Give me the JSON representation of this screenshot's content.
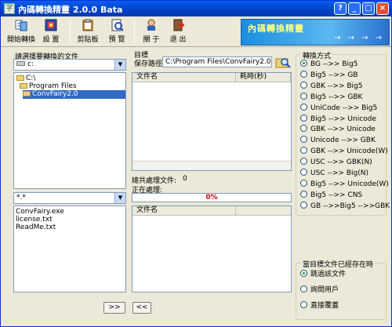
{
  "window": {
    "title": "內碼轉換精靈  2.0.0 Bata",
    "title_icon": "app-icon",
    "buttons": [
      "?",
      "_",
      "□",
      "×"
    ]
  },
  "toolbar": {
    "items": [
      {
        "label": "開始轉換",
        "icon": "convert-icon"
      },
      {
        "label": "設  置",
        "icon": "settings-icon"
      },
      {
        "label": "剪貼板",
        "icon": "clipboard-icon"
      },
      {
        "label": "預  覽",
        "icon": "preview-icon"
      },
      {
        "label": "關  于",
        "icon": "about-icon"
      },
      {
        "label": "退  出",
        "icon": "exit-icon"
      }
    ],
    "banner_text": "內碼轉換精靈",
    "banner_arrows": "→ → → →"
  },
  "left": {
    "heading": "請選擇要轉換的文件",
    "drive": "c:",
    "tree": [
      "C:\\",
      "Program Files",
      "ConvFairy2.0"
    ],
    "filter": "*.*",
    "files": [
      "ConvFairy.exe",
      "license.txt",
      "ReadMe.txt"
    ],
    "add_button": ">>"
  },
  "middle": {
    "heading": "目標",
    "save_path_label": "保存路徑",
    "save_path_value": "C:\\Program Files\\ConvFairy2.0",
    "columns": [
      "文件名",
      "耗時(秒)"
    ],
    "total_label": "總共處理文件:",
    "total_value": "0",
    "processing_label": "正在處理:",
    "progress_percent": 0,
    "progress_text": "0%",
    "queue_columns": [
      "文件名"
    ],
    "remove_button": "<<"
  },
  "right": {
    "heading": "轉換方式",
    "selected_index": 0,
    "options": [
      "BG -->> Big5",
      "Big5 -->> GB",
      "GBK -->> Big5",
      "Big5 -->> GBK",
      "UniCode -->> Big5",
      "Big5 -->> Unicode",
      "GBK -->> Unicode",
      "Unicode -->> GBK",
      "GBK -->> Unicode(W)",
      "USC -->> GBK(N)",
      "USC -->> Big(N)",
      "Big5 -->> Unicode(W)",
      "Big5 -->> CNS",
      "GB -->>Big5 -->>GBK"
    ],
    "exists_heading": "當目標文件已經存在時",
    "exists_selected_index": 0,
    "exists_options": [
      "跳過該文件",
      "詢問用戶",
      "直接覆蓋"
    ]
  },
  "colors": {
    "titlebar": "#0a5df0",
    "selection": "#316ac5",
    "progress_text": "#e00000"
  }
}
